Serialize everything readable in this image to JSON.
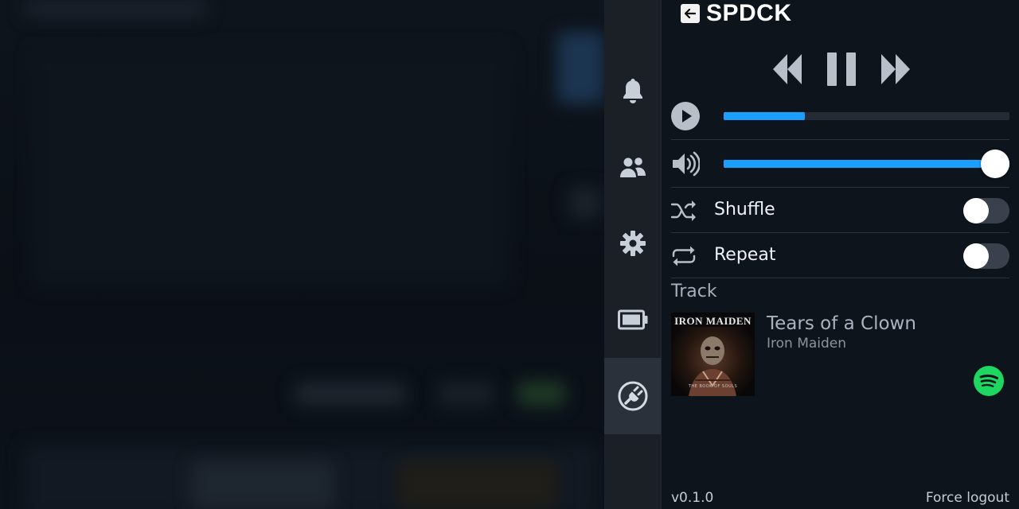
{
  "panel": {
    "title": "SPDCK",
    "back_icon": "arrow-left-icon"
  },
  "player": {
    "prev_icon": "rewind-icon",
    "pause_icon": "pause-icon",
    "next_icon": "fast-forward-icon",
    "progress_fraction": 0.285,
    "volume_fraction": 1.0
  },
  "options": {
    "shuffle_label": "Shuffle",
    "shuffle_on": false,
    "repeat_label": "Repeat",
    "repeat_on": false
  },
  "track": {
    "section_label": "Track",
    "title": "Tears of a Clown",
    "artist": "Iron Maiden",
    "album_art_band_text": "IRON MAIDEN",
    "album_art_subtitle": "THE BOOK OF SOULS"
  },
  "footer": {
    "version": "v0.1.0",
    "logout_label": "Force logout"
  },
  "sidebar": {
    "items": [
      "bell-icon",
      "friends-icon",
      "gear-icon",
      "battery-icon",
      "plug-icon"
    ],
    "active_index": 4
  },
  "colors": {
    "accent": "#1a9fff",
    "spotify": "#1ed760",
    "panel_bg": "#0e141b",
    "rail_bg": "#1b1f26"
  }
}
